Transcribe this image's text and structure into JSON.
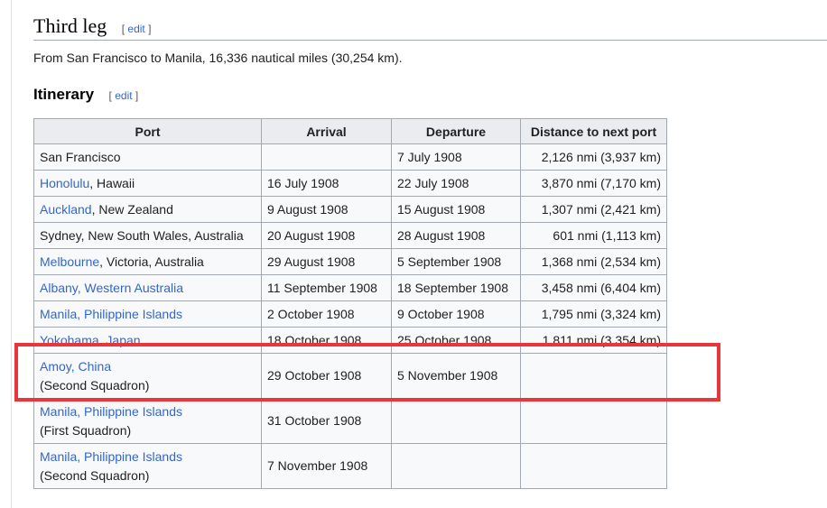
{
  "section": {
    "title": "Third leg",
    "edit_open": "[ ",
    "edit_label": "edit",
    "edit_close": " ]",
    "intro": "From San Francisco to Manila, 16,336 nautical miles (30,254 km)."
  },
  "subsection": {
    "title": "Itinerary",
    "edit_open": "[ ",
    "edit_label": "edit",
    "edit_close": " ]"
  },
  "table": {
    "headers": [
      "Port",
      "Arrival",
      "Departure",
      "Distance to next port"
    ],
    "rows": [
      {
        "port_link": "",
        "port_rest": "San Francisco",
        "port_note": "",
        "arrival": "",
        "departure": "7 July 1908",
        "distance": "2,126 nmi (3,937 km)"
      },
      {
        "port_link": "Honolulu",
        "port_rest": ", Hawaii",
        "port_note": "",
        "arrival": "16 July 1908",
        "departure": "22 July 1908",
        "distance": "3,870 nmi (7,170 km)"
      },
      {
        "port_link": "Auckland",
        "port_rest": ", New Zealand",
        "port_note": "",
        "arrival": "9 August 1908",
        "departure": "15 August 1908",
        "distance": "1,307 nmi (2,421 km)"
      },
      {
        "port_link": "",
        "port_rest": "Sydney, New South Wales, Australia",
        "port_note": "",
        "arrival": "20 August 1908",
        "departure": "28 August 1908",
        "distance": "601 nmi (1,113 km)"
      },
      {
        "port_link": "Melbourne",
        "port_rest": ", Victoria, Australia",
        "port_note": "",
        "arrival": "29 August 1908",
        "departure": "5 September 1908",
        "distance": "1,368 nmi (2,534 km)"
      },
      {
        "port_link": "Albany, Western Australia",
        "port_rest": "",
        "port_note": "",
        "arrival": "11 September 1908",
        "departure": "18 September 1908",
        "distance": "3,458 nmi (6,404 km)"
      },
      {
        "port_link": "Manila, Philippine Islands",
        "port_rest": "",
        "port_note": "",
        "arrival": "2 October 1908",
        "departure": "9 October 1908",
        "distance": "1,795 nmi (3,324 km)"
      },
      {
        "port_link": "Yokohama, Japan",
        "port_rest": "",
        "port_note": "",
        "arrival": "18 October 1908",
        "departure": "25 October 1908",
        "distance": "1,811 nmi (3,354 km)"
      },
      {
        "port_link": "Amoy, China",
        "port_rest": "",
        "port_note": "(Second Squadron)",
        "arrival": "29 October 1908",
        "departure": "5 November 1908",
        "distance": ""
      },
      {
        "port_link": "Manila, Philippine Islands",
        "port_rest": "",
        "port_note": "(First Squadron)",
        "arrival": "31 October 1908",
        "departure": "",
        "distance": ""
      },
      {
        "port_link": "Manila, Philippine Islands",
        "port_rest": "",
        "port_note": "(Second Squadron)",
        "arrival": "7 November 1908",
        "departure": "",
        "distance": ""
      }
    ]
  },
  "highlight_color": "#e8363a",
  "link_color": "#3366cc"
}
